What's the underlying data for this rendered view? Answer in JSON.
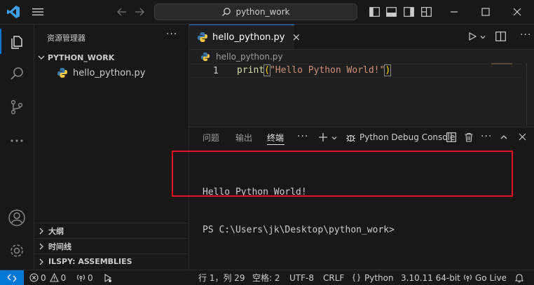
{
  "titlebar": {
    "search_text": "python_work"
  },
  "sidebar": {
    "title": "资源管理器",
    "more": "···",
    "folder": "PYTHON_WORK",
    "file": "hello_python.py",
    "sections": [
      "大纲",
      "时间线",
      "ILSPY: ASSEMBLIES"
    ]
  },
  "editor": {
    "tab_label": "hello_python.py",
    "tab_close": "×",
    "breadcrumb": "hello_python.py",
    "line_number": "1",
    "code": {
      "func": "print",
      "open_paren": "(",
      "string": "\"Hello Python World!\"",
      "close_paren": ")"
    }
  },
  "panel": {
    "tabs": [
      "问题",
      "输出",
      "终端"
    ],
    "active_tab_index": 2,
    "more": "···",
    "terminal_name": "Python Debug Console",
    "terminal_lines": [
      "Hello Python World!",
      "PS C:\\Users\\jk\\Desktop\\python_work>"
    ]
  },
  "statusbar": {
    "errors": "0",
    "warnings": "0",
    "ports": "0",
    "position": "行 1，列 29",
    "spaces": "空格: 2",
    "encoding": "UTF-8",
    "eol": "CRLF",
    "language": "Python",
    "interpreter": "3.10.11 64-bit",
    "golive": "Go Live"
  },
  "colors": {
    "accent": "#0078d4",
    "highlight_box": "#e81123",
    "python_blue": "#3b77a8",
    "python_yellow": "#f7c744"
  },
  "icons": [
    "vscode-logo-icon",
    "menu-icon",
    "back-arrow-icon",
    "forward-arrow-icon",
    "search-icon",
    "layout-icon",
    "explorer-icon",
    "search-view-icon",
    "source-control-icon",
    "more-icon",
    "account-icon",
    "settings-icon",
    "python-file-icon",
    "run-icon",
    "split-editor-icon",
    "add-terminal-icon",
    "trash-icon",
    "maximize-icon",
    "close-icon",
    "remote-icon",
    "error-icon",
    "warning-icon",
    "broadcast-icon",
    "bell-icon"
  ]
}
